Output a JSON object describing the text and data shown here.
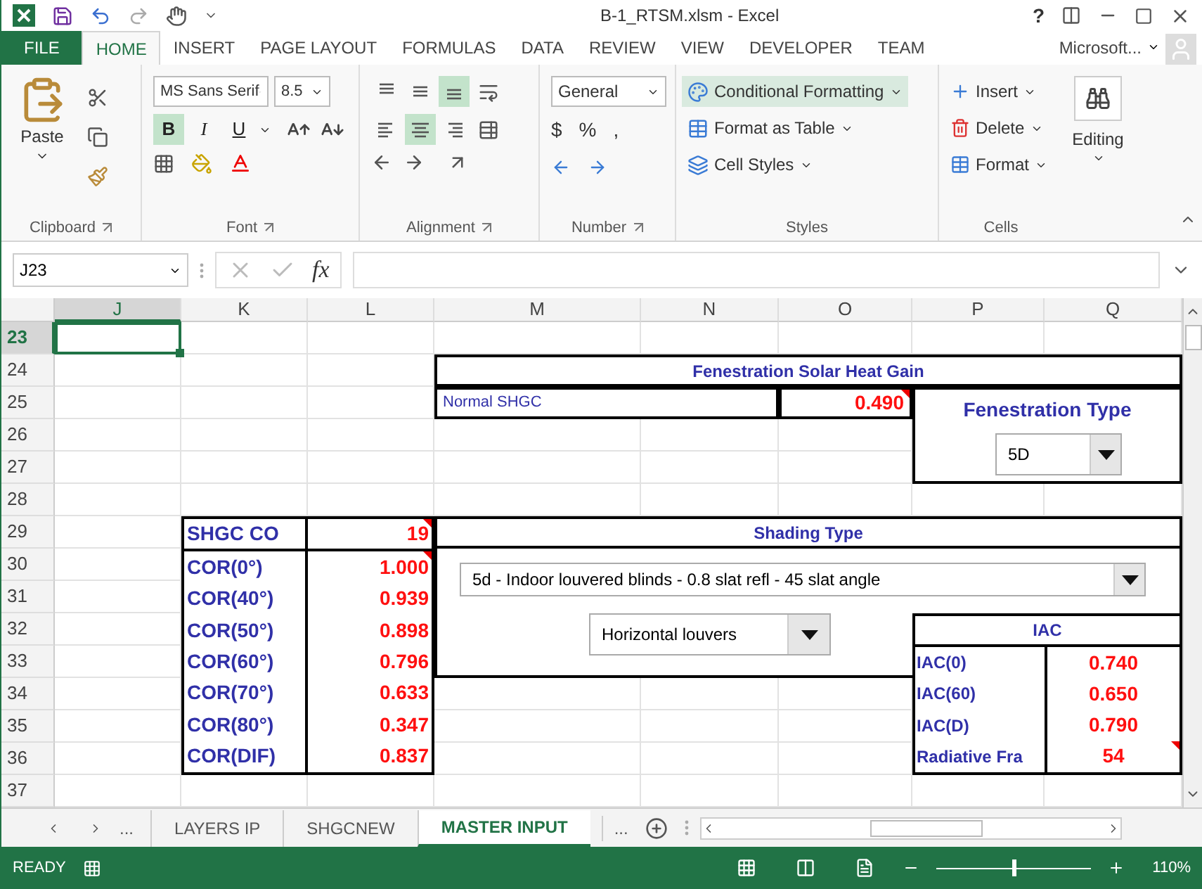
{
  "window": {
    "title": "B-1_RTSM.xlsm - Excel",
    "help": "?"
  },
  "ribbon_tabs": [
    {
      "label": "FILE",
      "kind": "file",
      "selected": false
    },
    {
      "label": "HOME",
      "kind": "tab",
      "selected": true
    },
    {
      "label": "INSERT",
      "kind": "tab",
      "selected": false
    },
    {
      "label": "PAGE LAYOUT",
      "kind": "tab",
      "selected": false
    },
    {
      "label": "FORMULAS",
      "kind": "tab",
      "selected": false
    },
    {
      "label": "DATA",
      "kind": "tab",
      "selected": false
    },
    {
      "label": "REVIEW",
      "kind": "tab",
      "selected": false
    },
    {
      "label": "VIEW",
      "kind": "tab",
      "selected": false
    },
    {
      "label": "DEVELOPER",
      "kind": "tab",
      "selected": false
    },
    {
      "label": "TEAM",
      "kind": "tab",
      "selected": false
    }
  ],
  "account": "Microsoft...",
  "clipboard": {
    "paste": "Paste",
    "group": "Clipboard"
  },
  "font": {
    "name": "MS Sans Serif",
    "size": "8.5",
    "group": "Font",
    "styles": [
      {
        "label": "B",
        "kind": "bold",
        "selected": true
      },
      {
        "label": "I",
        "kind": "italic",
        "selected": false
      },
      {
        "label": "U",
        "kind": "underline",
        "selected": false
      }
    ]
  },
  "alignment": {
    "group": "Alignment",
    "buttons": [
      {
        "kind": "top",
        "selected": false
      },
      {
        "kind": "middle",
        "selected": false
      },
      {
        "kind": "bottom",
        "selected": true
      },
      {
        "kind": "left",
        "selected": false
      },
      {
        "kind": "center",
        "selected": true
      },
      {
        "kind": "right",
        "selected": false
      }
    ]
  },
  "number": {
    "format": "General",
    "symbols": [
      "$",
      "%",
      ","
    ],
    "group": "Number"
  },
  "styles": {
    "group": "Styles",
    "buttons": [
      {
        "label": "Conditional Formatting",
        "highlighted": true
      },
      {
        "label": "Format as Table",
        "highlighted": false
      },
      {
        "label": "Cell Styles",
        "highlighted": false
      }
    ]
  },
  "cells": {
    "group": "Cells",
    "buttons": [
      "Insert",
      "Delete",
      "Format"
    ]
  },
  "editing": "Editing",
  "formula_bar": {
    "name_box": "J23",
    "fx": "fx"
  },
  "columns": [
    {
      "label": "J",
      "selected": true
    },
    {
      "label": "K",
      "selected": false
    },
    {
      "label": "L",
      "selected": false
    },
    {
      "label": "M",
      "selected": false
    },
    {
      "label": "N",
      "selected": false
    },
    {
      "label": "O",
      "selected": false
    },
    {
      "label": "P",
      "selected": false
    },
    {
      "label": "Q",
      "selected": false
    }
  ],
  "rows": [
    {
      "label": "23",
      "selected": true
    },
    {
      "label": "24",
      "selected": false
    },
    {
      "label": "25",
      "selected": false
    },
    {
      "label": "26",
      "selected": false
    },
    {
      "label": "27",
      "selected": false
    },
    {
      "label": "28",
      "selected": false
    },
    {
      "label": "29",
      "selected": false
    },
    {
      "label": "30",
      "selected": false
    },
    {
      "label": "31",
      "selected": false
    },
    {
      "label": "32",
      "selected": false
    },
    {
      "label": "33",
      "selected": false
    },
    {
      "label": "34",
      "selected": false
    },
    {
      "label": "35",
      "selected": false
    },
    {
      "label": "36",
      "selected": false
    },
    {
      "label": "37",
      "selected": false
    }
  ],
  "fenestration": {
    "title": "Fenestration Solar Heat Gain",
    "normal_label": "Normal SHGC",
    "normal_value": "0.490",
    "normal_comment": true,
    "type_label": "Fenestration Type",
    "type_value": "5D"
  },
  "shading": {
    "title": "Shading Type",
    "type_value": "5d - Indoor louvered blinds - 0.8 slat refl - 45 slat angle",
    "louvers_value": "Horizontal louvers"
  },
  "cor_table": {
    "label": "SHGC CO",
    "value": "19",
    "comment": true,
    "rows": [
      {
        "label": "COR(0°)",
        "value": "1.000",
        "comment": true
      },
      {
        "label": "COR(40°)",
        "value": "0.939",
        "comment": false
      },
      {
        "label": "COR(50°)",
        "value": "0.898",
        "comment": false
      },
      {
        "label": "COR(60°)",
        "value": "0.796",
        "comment": false
      },
      {
        "label": "COR(70°)",
        "value": "0.633",
        "comment": false
      },
      {
        "label": "COR(80°)",
        "value": "0.347",
        "comment": false
      },
      {
        "label": "COR(DIF)",
        "value": "0.837",
        "comment": false
      }
    ]
  },
  "iac_table": {
    "title": "IAC",
    "rows": [
      {
        "label": "IAC(0)",
        "value": "0.740",
        "comment": false
      },
      {
        "label": "IAC(60)",
        "value": "0.650",
        "comment": false
      },
      {
        "label": "IAC(D)",
        "value": "0.790",
        "comment": false
      },
      {
        "label": "Radiative Fra",
        "value": "54",
        "comment": true
      }
    ]
  },
  "sheet_tabs": {
    "before": "...",
    "after": "...",
    "tabs": [
      {
        "label": "LAYERS IP",
        "selected": false
      },
      {
        "label": "SHGCNEW",
        "selected": false
      },
      {
        "label": "MASTER INPUT",
        "selected": true
      }
    ]
  },
  "status": {
    "mode": "READY",
    "zoom": "110%",
    "zoom_slider": {
      "level": 0.5
    }
  }
}
